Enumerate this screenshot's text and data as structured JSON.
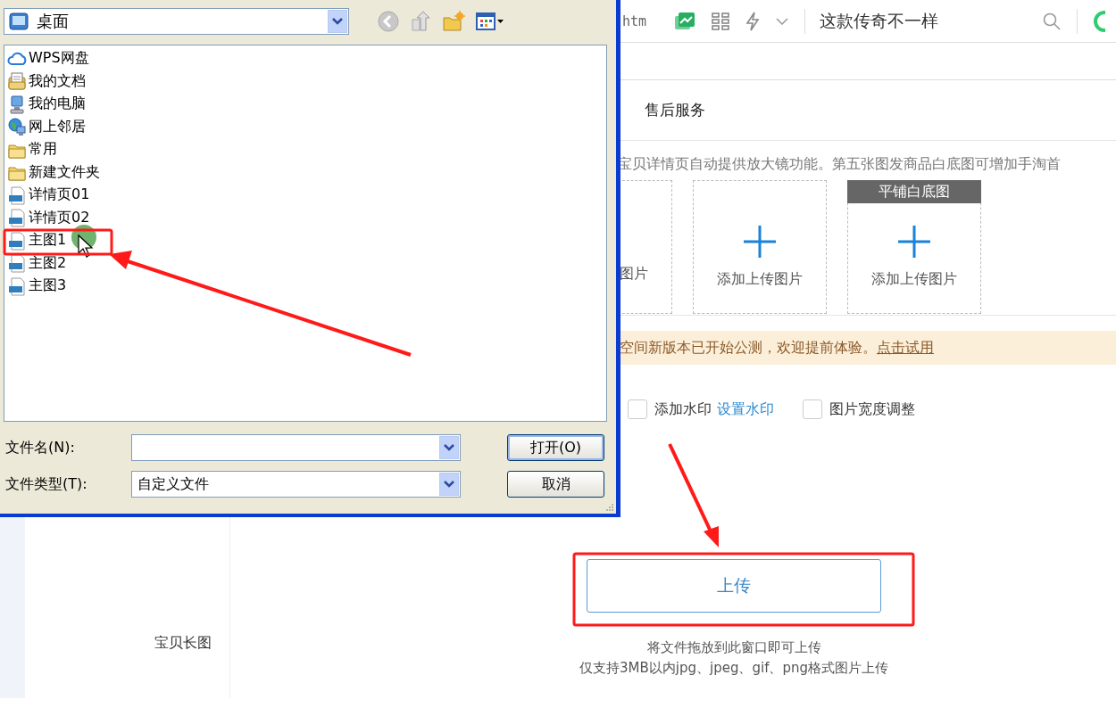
{
  "browser_toolbar": {
    "url_fragment": "htm",
    "search_text": "这款传奇不一样"
  },
  "page": {
    "section_tab": "售后服务",
    "hint": "宝贝详情页自动提供放大镜功能。第五张图发商品白底图可增加手淘首",
    "image_slots": [
      {
        "kind": "partial",
        "label": "图片"
      },
      {
        "kind": "full",
        "label": "添加上传图片"
      },
      {
        "kind": "full",
        "label": "添加上传图片",
        "badge": "平铺白底图"
      }
    ],
    "notice": {
      "text": "空间新版本已开始公测，欢迎提前体验。",
      "link": "点击试用"
    },
    "options": [
      {
        "label": "添加水印",
        "checked": false,
        "link": "设置水印"
      },
      {
        "label": "图片宽度调整",
        "checked": false
      }
    ],
    "row_label": "宝贝长图",
    "upload": {
      "button": "上传",
      "hint_lines": [
        "将文件拖放到此窗口即可上传",
        "仅支持3MB以内jpg、jpeg、gif、png格式图片上传"
      ]
    }
  },
  "file_dialog": {
    "location": "桌面",
    "items": [
      {
        "name": "WPS网盘",
        "kind": "cloud"
      },
      {
        "name": "我的文档",
        "kind": "documents"
      },
      {
        "name": "我的电脑",
        "kind": "computer"
      },
      {
        "name": "网上邻居",
        "kind": "network"
      },
      {
        "name": "常用",
        "kind": "folder"
      },
      {
        "name": "新建文件夹",
        "kind": "folder"
      },
      {
        "name": "详情页01",
        "kind": "image"
      },
      {
        "name": "详情页02",
        "kind": "image"
      },
      {
        "name": "主图1",
        "kind": "image"
      },
      {
        "name": "主图2",
        "kind": "image"
      },
      {
        "name": "主图3",
        "kind": "image"
      }
    ],
    "file_name_label": "文件名(N):",
    "file_type_label": "文件类型(T):",
    "file_type": "自定义文件",
    "buttons": [
      "打开(O)",
      "取消"
    ]
  }
}
